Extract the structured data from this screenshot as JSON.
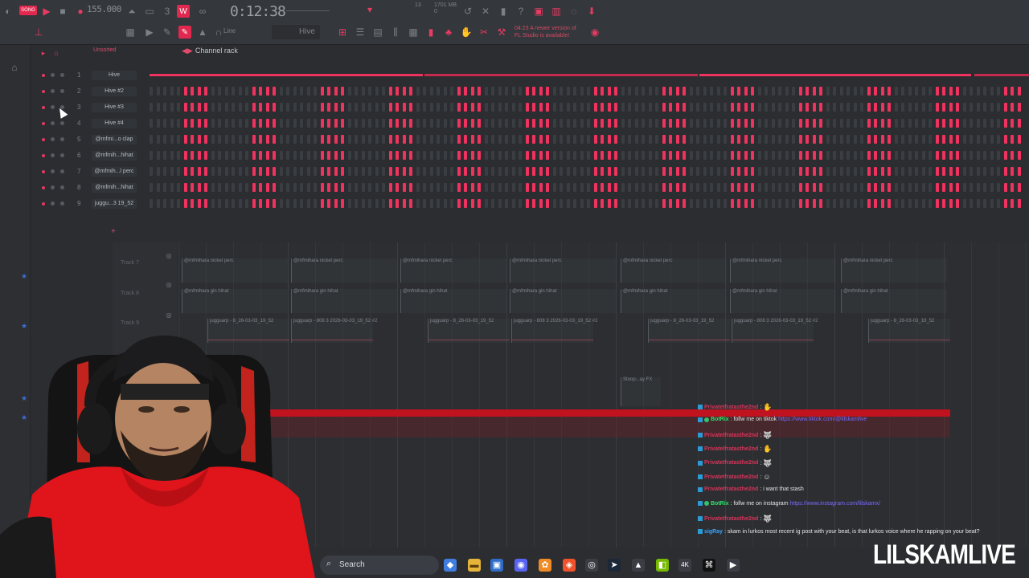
{
  "toolbar": {
    "song_mode": "SONG",
    "tempo": "155.000",
    "time": "0:12:38",
    "cpu": "13",
    "memory": "1701 MB",
    "memory_sub": "0",
    "mode_label": "Line",
    "pattern": "Hive",
    "update_notice_line1": "04:23  A newer version of",
    "update_notice_line2": "FL Studio is available!"
  },
  "channel_rack": {
    "sort_label": "Unsorted",
    "title": "Channel rack",
    "channels": [
      {
        "num": "1",
        "name": "Hive"
      },
      {
        "num": "2",
        "name": "Hive #2"
      },
      {
        "num": "3",
        "name": "Hive #3"
      },
      {
        "num": "4",
        "name": "Hive #4"
      },
      {
        "num": "5",
        "name": "@mfmi...o clap"
      },
      {
        "num": "6",
        "name": "@mfmih...hihat"
      },
      {
        "num": "7",
        "name": "@mfmih...l perc"
      },
      {
        "num": "8",
        "name": "@mfmih...hihat"
      },
      {
        "num": "9",
        "name": "juggu...3 19_52"
      }
    ],
    "add_label": "+"
  },
  "playlist": {
    "tracks": [
      {
        "label": "Track 7",
        "clip": "@mfmihara nickel perc"
      },
      {
        "label": "Track 8",
        "clip": "@mfmihara gin hihat"
      },
      {
        "label": "Track 9",
        "clip": "jugguarp - 8_26-03-03_19_52"
      }
    ],
    "track9_alt_clip": "jugguarp - 808 3 2026-03-03_19_52 #2",
    "fx_clip": "Stoop...ay FX"
  },
  "chat": {
    "messages": [
      {
        "user": "PrivateIfratasthe2nd",
        "text": "",
        "emote": "hand-emote"
      },
      {
        "user": "BotRix",
        "text": "follw me on tiktok",
        "link": "https://www.tiktok.com/@lilskamlive",
        "color": "green"
      },
      {
        "user": "PrivateIfratasthe2nd",
        "text": "",
        "emote": "wolf-emote"
      },
      {
        "user": "PrivateIfratasthe2nd",
        "text": "",
        "emote": "hand-emote"
      },
      {
        "user": "PrivateIfratasthe2nd",
        "text": "",
        "emote": "wolf-emote"
      },
      {
        "user": "PrivateIfratasthe2nd",
        "text": "",
        "emote": "face-emote"
      },
      {
        "user": "PrivateIfratasthe2nd",
        "text": "i want that stash"
      },
      {
        "user": "BotRix",
        "text": "follw me on instagram",
        "link": "https://www.instagram.com/lilskamx/",
        "color": "green"
      },
      {
        "user": "PrivateIfratasthe2nd",
        "text": "",
        "emote": "wolf-emote"
      },
      {
        "user": "sigRay",
        "text": "skam in lurkos most recent ig post with your beat, is that lurkos voice where he rapping on your beat?",
        "color": "blue"
      }
    ]
  },
  "taskbar": {
    "search_label": "Search"
  },
  "brand": "LILSKAMLIVE",
  "colors": {
    "accent": "#f0335e",
    "background": "#2b2d30",
    "bot_green": "#2ee36b",
    "link": "#7a6bff"
  }
}
